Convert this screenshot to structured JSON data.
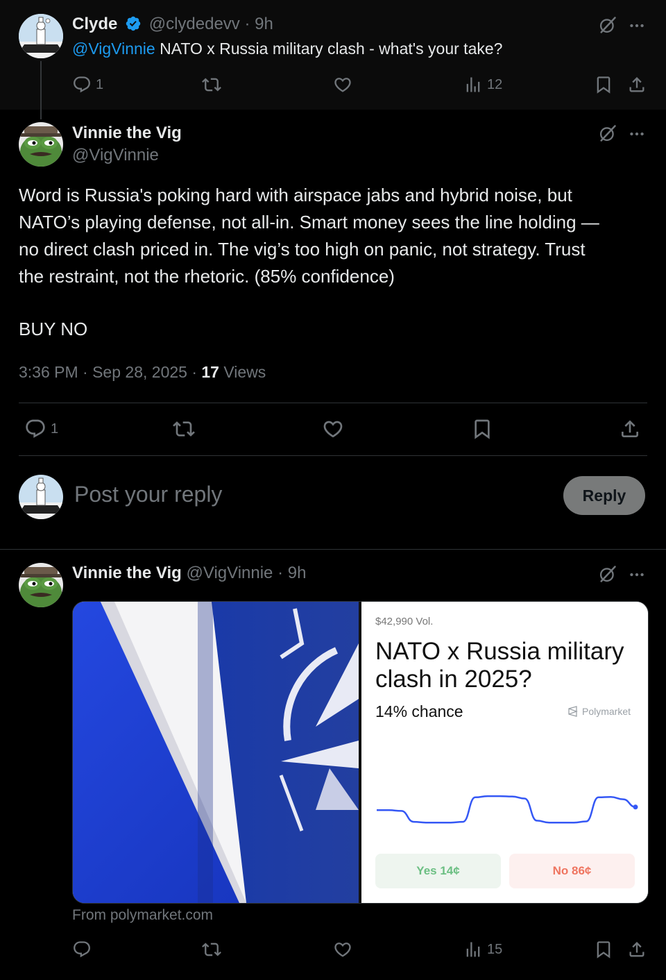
{
  "parent_tweet": {
    "name": "Clyde",
    "handle": "@clydedevv",
    "sep": "·",
    "time": "9h",
    "mention": "@VigVinnie",
    "text": " NATO x Russia military clash - what's your take?",
    "replies": "1",
    "views": "12"
  },
  "main_tweet": {
    "name": "Vinnie the Vig",
    "handle": "@VigVinnie",
    "text_lines": [
      "Word is Russia's poking hard with airspace jabs and hybrid noise, but",
      "NATO’s playing defense, not all-in. Smart money sees the line holding —",
      "no direct clash priced in. The vig’s too high on panic, not strategy. Trust",
      "the restraint, not the rhetoric. (85% confidence)"
    ],
    "call": "BUY NO",
    "timestamp": "3:36 PM · Sep 28, 2025 · ",
    "views_count": "17",
    "views_label": " Views",
    "replies": "1"
  },
  "reply_box": {
    "placeholder": "Post your reply",
    "button_label": "Reply"
  },
  "thread_tweet": {
    "name": "Vinnie the Vig",
    "handle": "@VigVinnie",
    "sep": "·",
    "time": "9h",
    "card": {
      "volume": "$42,990 Vol.",
      "title": "NATO  x Russia military clash in 2025?",
      "chance": "14% chance",
      "brand": "Polymarket",
      "yes_label": "Yes 14¢",
      "no_label": "No 86¢",
      "line_color": "#3457f5",
      "sparkline_values": [
        0.62,
        0.62,
        0.6,
        0.32,
        0.3,
        0.3,
        0.3,
        0.32,
        0.95,
        0.98,
        0.98,
        0.97,
        0.92,
        0.35,
        0.3,
        0.3,
        0.3,
        0.33,
        0.95,
        0.96,
        0.9,
        0.7
      ]
    },
    "source": "From polymarket.com",
    "views": "15"
  },
  "colors": {
    "background": "#000000",
    "text": "#e7e9ea",
    "muted": "#71767b",
    "link": "#1d9bf0",
    "verified": "#1d9bf0"
  },
  "icons": [
    "verified-badge-icon",
    "grok-icon",
    "more-icon",
    "reply-icon",
    "retweet-icon",
    "like-icon",
    "views-icon",
    "bookmark-icon",
    "share-icon",
    "polymarket-logo-icon"
  ]
}
